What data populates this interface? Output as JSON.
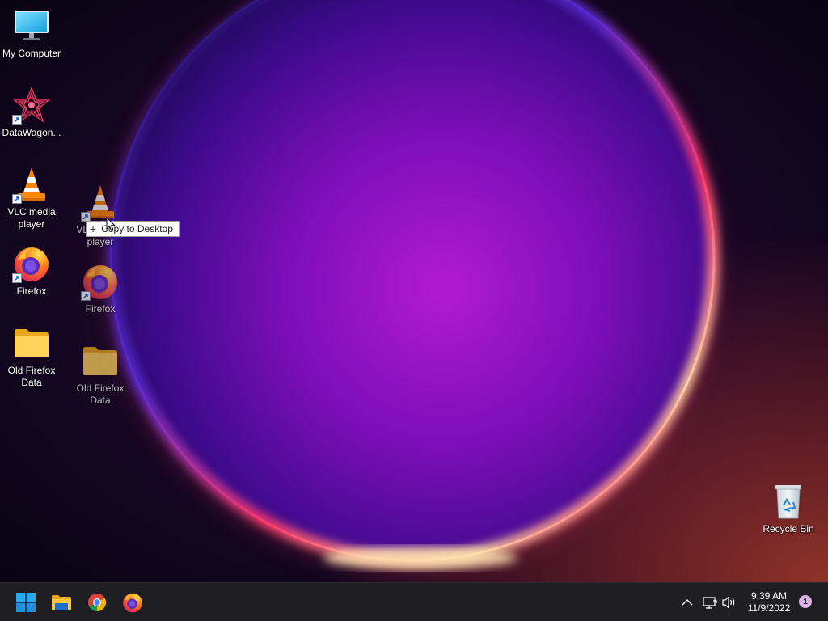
{
  "desktop": {
    "icons": [
      {
        "label": "My Computer",
        "icon": "computer-icon"
      },
      {
        "label": "DataWagon...",
        "icon": "datawagon-icon"
      },
      {
        "label": "VLC media player",
        "icon": "vlc-icon"
      },
      {
        "label": "Firefox",
        "icon": "firefox-icon"
      },
      {
        "label": "Old Firefox Data",
        "icon": "folder-icon"
      }
    ],
    "drag_ghosts": [
      {
        "label": "VLC media player",
        "icon": "vlc-icon"
      },
      {
        "label": "Firefox",
        "icon": "firefox-icon"
      },
      {
        "label": "Old Firefox Data",
        "icon": "folder-icon"
      }
    ],
    "recycle_bin": {
      "label": "Recycle Bin",
      "icon": "recycle-bin-icon"
    },
    "drag_tooltip": {
      "symbol": "+",
      "text": "Copy to Desktop"
    }
  },
  "taskbar": {
    "pinned": [
      {
        "name": "Start",
        "icon": "windows-start-icon"
      },
      {
        "name": "File Explorer",
        "icon": "file-explorer-icon"
      },
      {
        "name": "Google Chrome",
        "icon": "chrome-icon"
      },
      {
        "name": "Firefox",
        "icon": "firefox-icon"
      }
    ],
    "tray": {
      "overflow_icon": "chevron-up-icon",
      "network_icon": "network-icon",
      "volume_icon": "volume-icon"
    },
    "clock": {
      "time": "9:39 AM",
      "date": "11/9/2022"
    },
    "notification_count": "1"
  },
  "colors": {
    "taskbar_bg": "#1f1f23",
    "accent_start": "#0078d4"
  }
}
